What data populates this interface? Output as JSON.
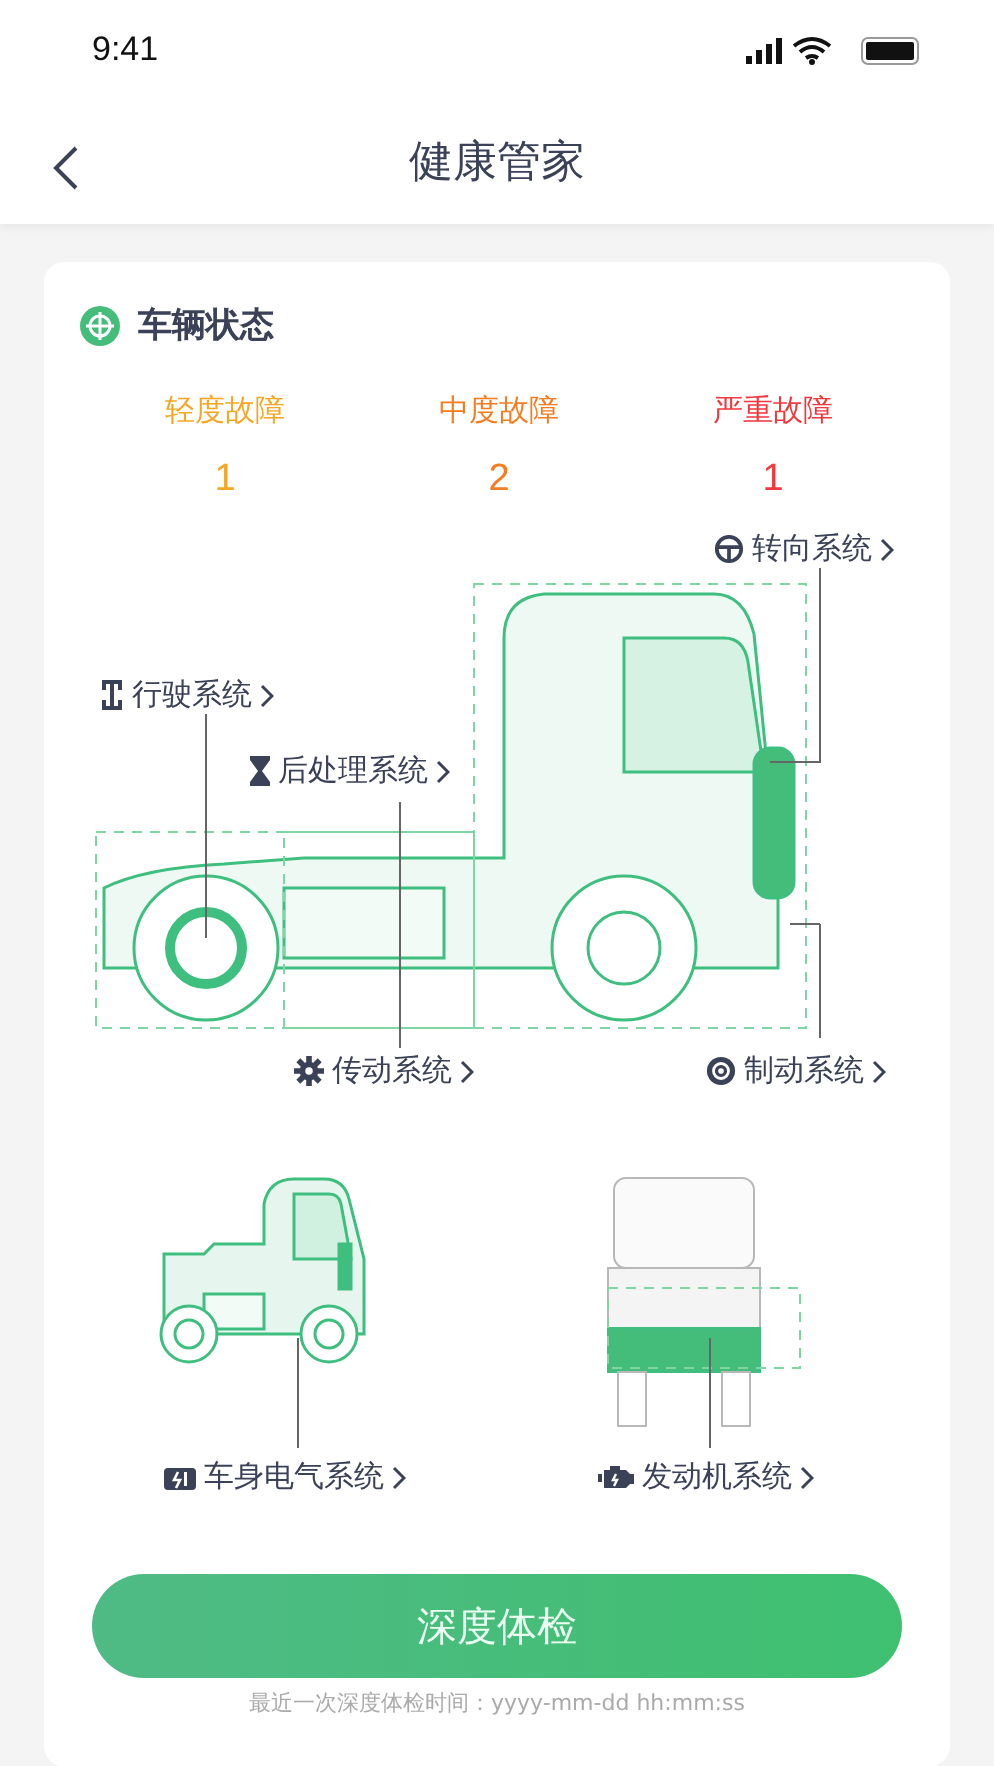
{
  "status_bar": {
    "time": "9:41"
  },
  "nav": {
    "title": "健康管家"
  },
  "card": {
    "title": "车辆状态",
    "faults": [
      {
        "label": "轻度故障",
        "count": "1",
        "color": "#f5a623"
      },
      {
        "label": "中度故障",
        "count": "2",
        "color": "#f57c1f"
      },
      {
        "label": "严重故障",
        "count": "1",
        "color": "#f0383f"
      }
    ],
    "main_systems": [
      {
        "label": "转向系统"
      },
      {
        "label": "行驶系统"
      },
      {
        "label": "后处理系统"
      },
      {
        "label": "传动系统"
      },
      {
        "label": "制动系统"
      }
    ],
    "other_systems": [
      {
        "label": "车身电气系统"
      },
      {
        "label": "发动机系统"
      }
    ],
    "button": "深度体检",
    "footnote": "最近一次深度体检时间：yyyy-mm-dd hh:mm:ss"
  }
}
